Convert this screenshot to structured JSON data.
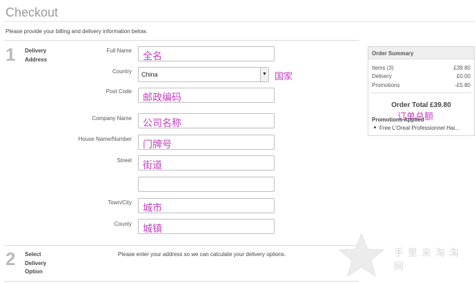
{
  "page": {
    "title": "Checkout",
    "intro": "Please provide your billing and delivery information below."
  },
  "step1": {
    "number": "1",
    "title": "Delivery Address",
    "fields": [
      {
        "label": "Full Name",
        "value": "全名"
      },
      {
        "label": "Country",
        "value": "China",
        "annotation": "国家"
      },
      {
        "label": "Post Code",
        "value": "邮政编码"
      },
      {
        "label": "Company Name",
        "value": "公司名称"
      },
      {
        "label": "House Name/Number",
        "value": "门牌号"
      },
      {
        "label": "Street",
        "value": "街道"
      },
      {
        "label": "",
        "value": ""
      },
      {
        "label": "Town/City",
        "value": "城市"
      },
      {
        "label": "County",
        "value": "城镇"
      }
    ]
  },
  "step2": {
    "number": "2",
    "title": "Select Delivery Option",
    "message": "Please enter your address so we can calculate your delivery options."
  },
  "summary": {
    "title": "Order Summary",
    "rows": [
      {
        "label": "Items (3)",
        "amount": "£39.80"
      },
      {
        "label": "Delivery",
        "amount": "£0.00"
      },
      {
        "label": "Promotions",
        "amount": "-£5.80"
      }
    ],
    "total": "Order Total £39.80",
    "total_annotation": "订单总额",
    "promotions_title": "Promotions Applied",
    "promotions": [
      "Free L'Oreal Professionnel Hai..."
    ]
  },
  "watermark": {
    "text": "手里来淘淘网",
    "icon": "star-icon"
  },
  "colors": {
    "annotation": "#c23fc0",
    "step_number": "#b9b9b9",
    "title": "#9a9a9a"
  }
}
